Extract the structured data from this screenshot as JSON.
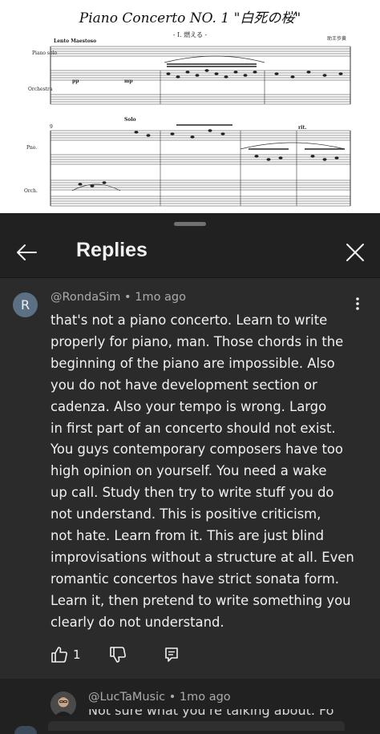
{
  "video": {
    "title": "Piano Concerto NO. 1 \"白死の桜\"",
    "movement": "- I. 燃える -",
    "composer": "助王歩黄",
    "tempo": "Lento Maestoso",
    "labels": {
      "piano_solo": "Piano solo",
      "orchestra": "Orchestra",
      "solo": "Solo",
      "measure": "9",
      "pno": "Pno.",
      "orch": "Orch.",
      "rit": "rit.",
      "pp": "pp",
      "mp": "mp"
    }
  },
  "panel": {
    "title": "Replies",
    "icons": {
      "back": "arrow-left-icon",
      "close": "close-icon"
    }
  },
  "comment": {
    "avatar_letter": "R",
    "author": "@RondaSim",
    "separator": "•",
    "time": "1mo ago",
    "lines": [
      "that's not a piano concerto. Learn to write",
      "properly for piano, man. Those chords in  the",
      "beginning of the piano are impossible. Also",
      "you do not have development section or",
      "cadenza. Also your tempo is wrong. Largo",
      "in first part of an concerto should not exist.",
      "You guys contemporary composers have too",
      "high opinion on yourself. You need a wake",
      "up call. Study then try to write stuff you do",
      "not understand. This is positive criticism,",
      "not hate. Learn from it. This are just blind",
      "improvisations without a structure at all. Even",
      "romantic concertos have strict sonata form.",
      "Learn it, then pretend to write something you",
      "clearly do not understand."
    ],
    "likes": "1",
    "icons": {
      "like": "thumbs-up-icon",
      "dislike": "thumbs-down-icon",
      "reply": "reply-comment-icon",
      "menu": "more-vert-icon"
    }
  },
  "reply2": {
    "author": "@LucTaMusic",
    "separator": "•",
    "time": "1mo ago",
    "partial_text": "Not sure what you're talking about. Fo"
  }
}
